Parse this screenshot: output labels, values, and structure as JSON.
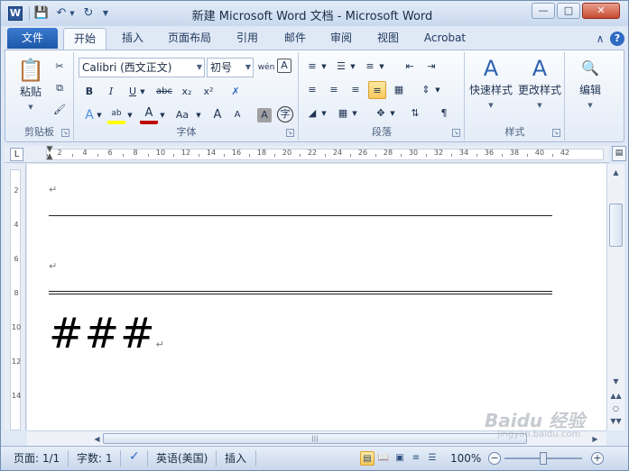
{
  "window": {
    "title": "新建 Microsoft Word 文档 - Microsoft Word",
    "app_icon_letter": "W"
  },
  "quick_access": {
    "save_icon": "save-icon",
    "undo_icon": "undo-icon",
    "redo_icon": "redo-icon"
  },
  "tabs": {
    "file": "文件",
    "items": [
      "开始",
      "插入",
      "页面布局",
      "引用",
      "邮件",
      "审阅",
      "视图",
      "Acrobat"
    ],
    "active": "开始"
  },
  "ribbon": {
    "clipboard": {
      "label": "剪贴板",
      "paste": "粘贴"
    },
    "font": {
      "label": "字体",
      "font_name": "Calibri (西文正文)",
      "font_size": "初号",
      "wen_icon": "wén",
      "bold": "B",
      "italic": "I",
      "underline": "U",
      "strike": "abc",
      "subscript": "x₂",
      "superscript": "x²",
      "grow": "A",
      "shrink": "A",
      "change_case": "Aa",
      "char_border": "A",
      "enclose": "字"
    },
    "paragraph": {
      "label": "段落"
    },
    "styles": {
      "label": "样式",
      "quick_styles": "快速样式",
      "change_styles": "更改样式"
    },
    "editing": {
      "label": "编辑"
    }
  },
  "ruler": {
    "numbers": [
      "2",
      "4",
      "6",
      "8",
      "10",
      "12",
      "14",
      "16",
      "18",
      "20",
      "22",
      "24",
      "26",
      "28",
      "30",
      "32",
      "34",
      "36",
      "38",
      "40",
      "42"
    ],
    "vertical_numbers": [
      "2",
      "4",
      "6",
      "8",
      "10",
      "12",
      "14"
    ]
  },
  "document": {
    "paragraph_mark": "↵",
    "hash_text": "###"
  },
  "status": {
    "page": "页面: 1/1",
    "words": "字数: 1",
    "language": "英语(美国)",
    "mode": "插入",
    "zoom": "100%",
    "zoom_level": 1.0
  },
  "watermark": {
    "brand": "Baidu 经验",
    "sub": "jingyan.baidu.com"
  },
  "colors": {
    "accent": "#2b5797",
    "file_tab": "#1d58a8",
    "selected": "#f7c85b",
    "highlight": "#ffff00",
    "font_color": "#c00000"
  }
}
